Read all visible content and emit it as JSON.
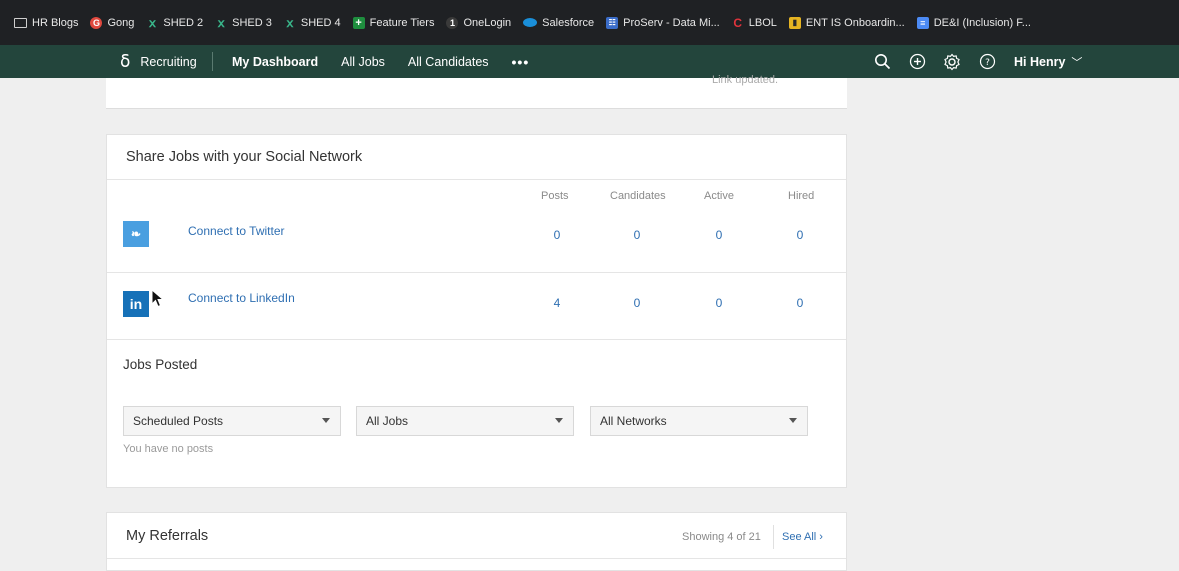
{
  "bookmarks": [
    {
      "label": "HR Blogs",
      "icon": "folder-icon"
    },
    {
      "label": "Gong",
      "icon": "gong-icon"
    },
    {
      "label": "SHED 2",
      "icon": "sprout-icon"
    },
    {
      "label": "SHED 3",
      "icon": "sprout-icon"
    },
    {
      "label": "SHED 4",
      "icon": "sprout-icon"
    },
    {
      "label": "Feature Tiers",
      "icon": "plus-box-icon"
    },
    {
      "label": "OneLogin",
      "icon": "onelogin-icon"
    },
    {
      "label": "Salesforce",
      "icon": "cloud-icon"
    },
    {
      "label": "ProServ - Data Mi...",
      "icon": "table-icon"
    },
    {
      "label": "LBOL",
      "icon": "c-logo-icon"
    },
    {
      "label": "ENT IS Onboardin...",
      "icon": "book-icon"
    },
    {
      "label": "DE&I (Inclusion) F...",
      "icon": "doc-icon"
    }
  ],
  "nav": {
    "brand": "Recruiting",
    "links": [
      "My Dashboard",
      "All Jobs",
      "All Candidates"
    ],
    "more": "•••",
    "user": "Hi Henry"
  },
  "top_card": {
    "status": "Link updated."
  },
  "share": {
    "title": "Share Jobs with your Social Network",
    "columns": [
      "Posts",
      "Candidates",
      "Active",
      "Hired"
    ],
    "networks": [
      {
        "label": "Connect to Twitter",
        "icon_glyph": "❧",
        "posts": "0",
        "candidates": "0",
        "active": "0",
        "hired": "0"
      },
      {
        "label": "Connect to LinkedIn",
        "icon_glyph": "in",
        "posts": "4",
        "candidates": "0",
        "active": "0",
        "hired": "0"
      }
    ]
  },
  "jobs_posted": {
    "title": "Jobs Posted",
    "filters": [
      "Scheduled Posts",
      "All Jobs",
      "All Networks"
    ],
    "empty": "You have no posts"
  },
  "referrals": {
    "title": "My Referrals",
    "showing": "Showing 4 of 21",
    "see_all": "See All ›"
  },
  "colors": {
    "nav_bg": "#23453c",
    "link": "#2f6fb2",
    "twitter": "#4a9fe0",
    "linkedin": "#1671b8"
  }
}
